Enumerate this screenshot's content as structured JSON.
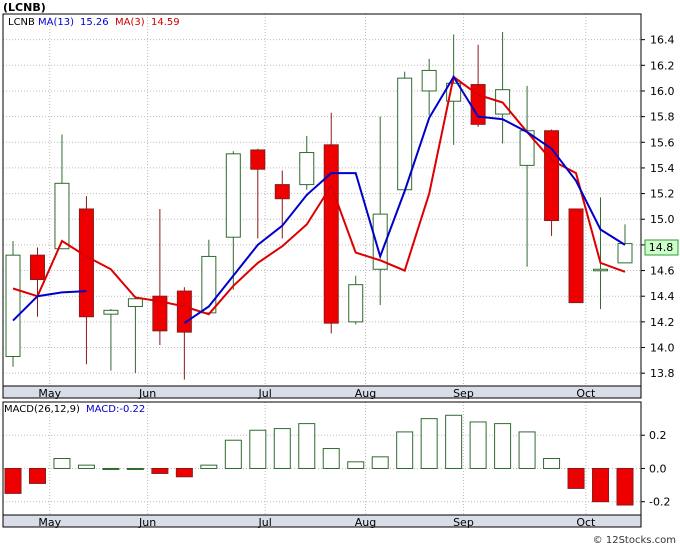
{
  "chart_data": {
    "type": "candlestick",
    "ticker_label": "(LCNB)",
    "legend": {
      "series": [
        {
          "name": "LCNB",
          "color": "#000000"
        },
        {
          "name": "MA(13)",
          "value": "15.26",
          "color": "#0000cc"
        },
        {
          "name": "MA(3)",
          "value": "14.59",
          "color": "#cc0000"
        }
      ]
    },
    "last_price_label": "14.8",
    "watermark": "© 12Stocks.com",
    "x_labels": [
      "May",
      "Jun",
      "Jul",
      "Aug",
      "Sep",
      "Oct"
    ],
    "price": {
      "ylim": [
        13.7,
        16.6
      ],
      "ticks": [
        "13.8",
        "14.0",
        "14.2",
        "14.4",
        "14.6",
        "14.8",
        "15.0",
        "15.2",
        "15.4",
        "15.6",
        "15.8",
        "16.0",
        "16.2",
        "16.4"
      ],
      "grid": true,
      "candles": [
        {
          "o": 13.93,
          "c": 14.72,
          "h": 14.83,
          "l": 13.85
        },
        {
          "o": 14.72,
          "c": 14.53,
          "h": 14.78,
          "l": 14.24
        },
        {
          "o": 14.77,
          "c": 15.28,
          "h": 15.66,
          "l": 14.77
        },
        {
          "o": 15.08,
          "c": 14.24,
          "h": 15.18,
          "l": 13.87
        },
        {
          "o": 14.26,
          "c": 14.29,
          "h": 14.3,
          "l": 13.82
        },
        {
          "o": 14.32,
          "c": 14.38,
          "h": 14.4,
          "l": 13.8
        },
        {
          "o": 14.4,
          "c": 14.13,
          "h": 15.08,
          "l": 14.02
        },
        {
          "o": 14.44,
          "c": 14.12,
          "h": 14.47,
          "l": 13.75
        },
        {
          "o": 14.27,
          "c": 14.71,
          "h": 14.84,
          "l": 14.26
        },
        {
          "o": 14.86,
          "c": 15.51,
          "h": 15.53,
          "l": 14.45
        },
        {
          "o": 15.54,
          "c": 15.39,
          "h": 15.55,
          "l": 14.85
        },
        {
          "o": 15.27,
          "c": 15.16,
          "h": 15.38,
          "l": 14.85
        },
        {
          "o": 15.27,
          "c": 15.52,
          "h": 15.65,
          "l": 15.23
        },
        {
          "o": 15.58,
          "c": 14.19,
          "h": 15.83,
          "l": 14.11
        },
        {
          "o": 14.2,
          "c": 14.49,
          "h": 14.56,
          "l": 14.18
        },
        {
          "o": 14.61,
          "c": 15.04,
          "h": 15.8,
          "l": 14.33
        },
        {
          "o": 15.23,
          "c": 16.1,
          "h": 16.15,
          "l": 15.22
        },
        {
          "o": 16.0,
          "c": 16.16,
          "h": 16.25,
          "l": 15.81
        },
        {
          "o": 15.92,
          "c": 16.06,
          "h": 16.44,
          "l": 15.58
        },
        {
          "o": 16.05,
          "c": 15.74,
          "h": 16.36,
          "l": 15.72
        },
        {
          "o": 15.82,
          "c": 16.01,
          "h": 16.46,
          "l": 15.59
        },
        {
          "o": 15.42,
          "c": 15.69,
          "h": 16.04,
          "l": 14.63
        },
        {
          "o": 15.69,
          "c": 14.99,
          "h": 15.7,
          "l": 14.87
        },
        {
          "o": 15.08,
          "c": 14.35,
          "h": 15.08,
          "l": 14.35
        },
        {
          "o": 14.6,
          "c": 14.61,
          "h": 15.17,
          "l": 14.3
        },
        {
          "o": 14.66,
          "c": 14.81,
          "h": 14.96,
          "l": 14.66
        }
      ],
      "ma13": [
        14.21,
        14.4,
        14.43,
        14.44,
        null,
        null,
        null,
        14.19,
        14.32,
        14.56,
        14.8,
        14.95,
        15.19,
        15.36,
        15.36,
        14.71,
        15.22,
        15.79,
        16.11,
        15.8,
        15.78,
        15.68,
        15.55,
        15.3,
        14.92,
        14.8
      ],
      "ma13_plot": [
        14.21,
        14.4,
        14.43,
        14.44,
        null,
        null,
        null,
        14.19,
        14.32,
        14.56,
        14.8,
        14.95,
        15.19,
        15.36,
        15.36,
        14.71,
        15.22,
        15.79,
        16.11,
        15.8,
        15.78,
        15.68,
        15.55,
        15.3,
        14.92,
        14.8
      ],
      "ma3": [
        14.46,
        14.4,
        14.83,
        14.71,
        14.61,
        14.39,
        14.36,
        14.32,
        14.26,
        14.48,
        14.66,
        14.79,
        14.96,
        15.26,
        14.74,
        14.68,
        14.6,
        15.2,
        16.11,
        15.97,
        15.91,
        15.68,
        15.46,
        15.36,
        14.66,
        14.59
      ]
    },
    "macd": {
      "label": "MACD(26,12,9)",
      "value_label": "MACD:-0.22",
      "ylim": [
        -0.28,
        0.4
      ],
      "ticks": [
        "0.2",
        "0.0",
        "-0.2"
      ],
      "values": [
        -0.15,
        -0.09,
        0.06,
        0.02,
        0.0,
        0.0,
        -0.03,
        -0.05,
        0.02,
        0.17,
        0.23,
        0.24,
        0.27,
        0.12,
        0.04,
        0.07,
        0.22,
        0.3,
        0.32,
        0.28,
        0.27,
        0.22,
        0.06,
        -0.12,
        -0.2,
        -0.22
      ]
    }
  }
}
